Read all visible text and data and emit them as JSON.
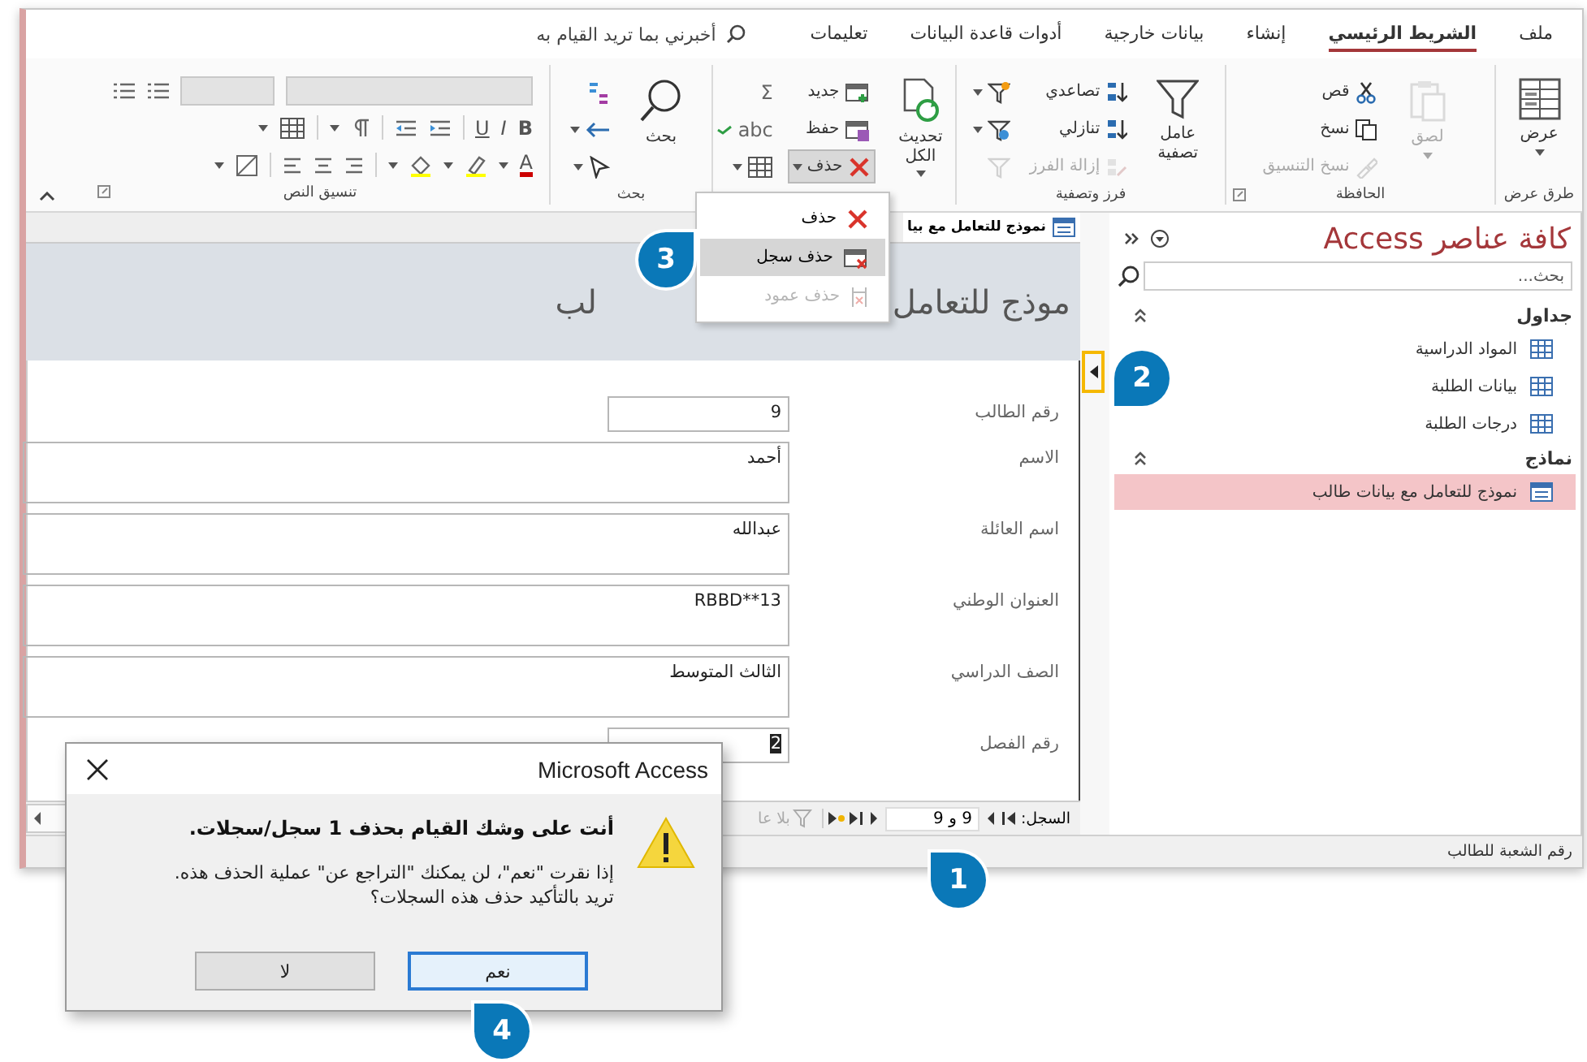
{
  "tabs": [
    {
      "label": "ملف",
      "selected": false
    },
    {
      "label": "الشريط الرئيسي",
      "selected": true
    },
    {
      "label": "إنشاء",
      "selected": false
    },
    {
      "label": "بيانات خارجية",
      "selected": false
    },
    {
      "label": "أدوات قاعدة البيانات",
      "selected": false
    },
    {
      "label": "تعليمات",
      "selected": false
    }
  ],
  "tell_me": {
    "placeholder": "أخبرني بما تريد القيام به"
  },
  "ribbon": {
    "groups": [
      {
        "label": "طرق عرض",
        "launcher": false,
        "buttons": [
          {
            "kind": "large",
            "label": "عرض",
            "dropdown": true,
            "disabled": false,
            "pressed": false
          }
        ]
      },
      {
        "label": "الحافظة",
        "launcher": true,
        "buttons": [
          {
            "kind": "large",
            "label": "لصق",
            "dropdown": true,
            "disabled": true,
            "pressed": false
          },
          {
            "kind": "small",
            "label": "قص",
            "dropdown": false,
            "disabled": false,
            "pressed": false
          },
          {
            "kind": "small",
            "label": "نسخ",
            "dropdown": false,
            "disabled": false,
            "pressed": false
          },
          {
            "kind": "small",
            "label": "نسخ التنسيق",
            "dropdown": false,
            "disabled": true,
            "pressed": false
          }
        ]
      },
      {
        "label": "فرز وتصفية",
        "launcher": false,
        "buttons": [
          {
            "kind": "large",
            "label": "عامل تصفية",
            "dropdown": false,
            "disabled": false,
            "pressed": false
          },
          {
            "kind": "small",
            "label": "تصاعدي",
            "dropdown": false,
            "disabled": false,
            "pressed": false
          },
          {
            "kind": "small",
            "label": "تنازلي",
            "dropdown": false,
            "disabled": false,
            "pressed": false
          },
          {
            "kind": "small",
            "label": "إزالة الفرز",
            "dropdown": false,
            "disabled": true,
            "pressed": false
          },
          {
            "kind": "icon",
            "dropdown": true,
            "disabled": false,
            "pressed": false
          },
          {
            "kind": "icon",
            "dropdown": true,
            "disabled": false,
            "pressed": false
          },
          {
            "kind": "icon",
            "dropdown": false,
            "disabled": true,
            "pressed": false
          }
        ]
      },
      {
        "launcher": false,
        "buttons": [
          {
            "kind": "large",
            "label": "تحديث الكل",
            "dropdown": true,
            "disabled": false,
            "pressed": false
          },
          {
            "kind": "small",
            "label": "جديد",
            "dropdown": false,
            "disabled": false,
            "pressed": false
          },
          {
            "kind": "small",
            "label": "حفظ",
            "dropdown": false,
            "disabled": false,
            "pressed": false
          },
          {
            "kind": "small",
            "label": "حذف",
            "dropdown": true,
            "disabled": false,
            "pressed": true
          },
          {
            "kind": "icon",
            "glyph": "Σ",
            "dropdown": false,
            "disabled": false,
            "pressed": false
          },
          {
            "kind": "icon",
            "glyph": "abc",
            "dropdown": false,
            "disabled": false,
            "pressed": false
          },
          {
            "kind": "icon",
            "dropdown": true,
            "disabled": false,
            "pressed": false
          }
        ]
      },
      {
        "label": "بحث",
        "launcher": false,
        "buttons": [
          {
            "kind": "large",
            "label": "بحث",
            "dropdown": false,
            "disabled": false,
            "pressed": false
          },
          {
            "kind": "icon",
            "dropdown": false,
            "disabled": false,
            "pressed": false
          },
          {
            "kind": "icon",
            "dropdown": true,
            "disabled": false,
            "pressed": false
          },
          {
            "kind": "icon",
            "dropdown": true,
            "disabled": false,
            "pressed": false
          }
        ]
      }
    ],
    "text_format": {
      "label": "تنسيق النص",
      "launcher": true,
      "font_box": {
        "disabled": true
      },
      "size_box": {
        "disabled": true
      },
      "style_glyphs": [
        "B",
        "I",
        "U"
      ],
      "color_glyph": "A"
    }
  },
  "nav": {
    "title": "كافة عناصر Access",
    "search": {
      "placeholder": "بحث..."
    },
    "groups": [
      {
        "label": "جداول",
        "expanded": true,
        "items": [
          {
            "label": "المواد الدراسية",
            "selected": false
          },
          {
            "label": "بيانات الطلبة",
            "selected": false
          },
          {
            "label": "درجات الطلبة",
            "selected": false
          }
        ]
      },
      {
        "label": "نماذج",
        "expanded": true,
        "items": [
          {
            "label": "نموذج للتعامل مع بيانات طالب",
            "selected": true
          }
        ]
      }
    ]
  },
  "form": {
    "document_tab": "نموذج للتعامل مع بيا",
    "header_title_parts": [
      "موذج للتعامل",
      "لب"
    ],
    "fields": [
      {
        "label": "رقم الطالب",
        "value": "9",
        "kind": "short",
        "text_selected": false
      },
      {
        "label": "الاسم",
        "value": "أحمد",
        "kind": "tall",
        "text_selected": false
      },
      {
        "label": "اسم العائلة",
        "value": "عبدالله",
        "kind": "tall",
        "text_selected": false
      },
      {
        "label": "العنوان الوطني",
        "value": "RBBD**13",
        "kind": "tall",
        "text_selected": false
      },
      {
        "label": "الصف الدراسي",
        "value": "الثالث المتوسط",
        "kind": "tall",
        "text_selected": false
      },
      {
        "label": "رقم الفصل",
        "value": "2",
        "kind": "short",
        "text_selected": true
      }
    ],
    "record_nav": {
      "label": "السجل:",
      "position": "9 و 9",
      "filter": "بلا عا"
    }
  },
  "status_bar": {
    "text": "رقم الشعبة للطالب"
  },
  "menu": {
    "items": [
      {
        "label": "حذف",
        "selected": false,
        "disabled": false
      },
      {
        "label": "حذف سجل",
        "selected": true,
        "disabled": false
      },
      {
        "label": "حذف عمود",
        "selected": false,
        "disabled": true
      }
    ]
  },
  "dialog": {
    "title": "Microsoft Access",
    "heading": "أنت على وشك القيام بحذف 1 سجل/سجلات.",
    "message": "إذا نقرت \"نعم\"، لن يمكنك \"التراجع عن\" عملية الحذف هذه. تريد بالتأكيد حذف هذه السجلات؟",
    "buttons": [
      {
        "label": "نعم",
        "default": true
      },
      {
        "label": "لا",
        "default": false
      }
    ]
  },
  "callouts": [
    {
      "number": "1"
    },
    {
      "number": "2"
    },
    {
      "number": "3"
    },
    {
      "number": "4"
    }
  ]
}
